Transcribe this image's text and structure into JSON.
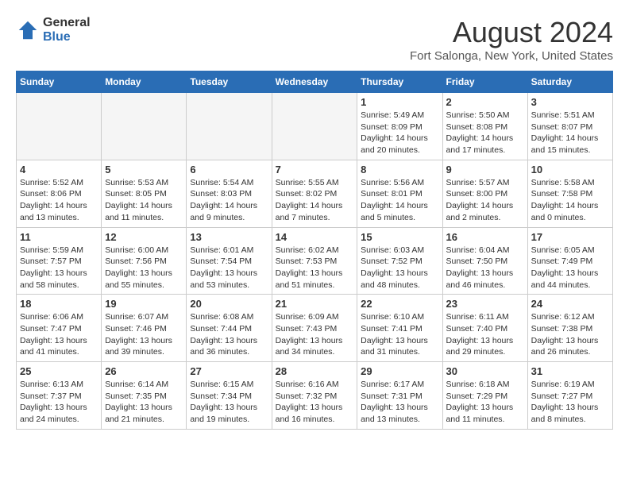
{
  "logo": {
    "general": "General",
    "blue": "Blue"
  },
  "title": "August 2024",
  "location": "Fort Salonga, New York, United States",
  "days_of_week": [
    "Sunday",
    "Monday",
    "Tuesday",
    "Wednesday",
    "Thursday",
    "Friday",
    "Saturday"
  ],
  "weeks": [
    [
      {
        "day": "",
        "info": ""
      },
      {
        "day": "",
        "info": ""
      },
      {
        "day": "",
        "info": ""
      },
      {
        "day": "",
        "info": ""
      },
      {
        "day": "1",
        "info": "Sunrise: 5:49 AM\nSunset: 8:09 PM\nDaylight: 14 hours\nand 20 minutes."
      },
      {
        "day": "2",
        "info": "Sunrise: 5:50 AM\nSunset: 8:08 PM\nDaylight: 14 hours\nand 17 minutes."
      },
      {
        "day": "3",
        "info": "Sunrise: 5:51 AM\nSunset: 8:07 PM\nDaylight: 14 hours\nand 15 minutes."
      }
    ],
    [
      {
        "day": "4",
        "info": "Sunrise: 5:52 AM\nSunset: 8:06 PM\nDaylight: 14 hours\nand 13 minutes."
      },
      {
        "day": "5",
        "info": "Sunrise: 5:53 AM\nSunset: 8:05 PM\nDaylight: 14 hours\nand 11 minutes."
      },
      {
        "day": "6",
        "info": "Sunrise: 5:54 AM\nSunset: 8:03 PM\nDaylight: 14 hours\nand 9 minutes."
      },
      {
        "day": "7",
        "info": "Sunrise: 5:55 AM\nSunset: 8:02 PM\nDaylight: 14 hours\nand 7 minutes."
      },
      {
        "day": "8",
        "info": "Sunrise: 5:56 AM\nSunset: 8:01 PM\nDaylight: 14 hours\nand 5 minutes."
      },
      {
        "day": "9",
        "info": "Sunrise: 5:57 AM\nSunset: 8:00 PM\nDaylight: 14 hours\nand 2 minutes."
      },
      {
        "day": "10",
        "info": "Sunrise: 5:58 AM\nSunset: 7:58 PM\nDaylight: 14 hours\nand 0 minutes."
      }
    ],
    [
      {
        "day": "11",
        "info": "Sunrise: 5:59 AM\nSunset: 7:57 PM\nDaylight: 13 hours\nand 58 minutes."
      },
      {
        "day": "12",
        "info": "Sunrise: 6:00 AM\nSunset: 7:56 PM\nDaylight: 13 hours\nand 55 minutes."
      },
      {
        "day": "13",
        "info": "Sunrise: 6:01 AM\nSunset: 7:54 PM\nDaylight: 13 hours\nand 53 minutes."
      },
      {
        "day": "14",
        "info": "Sunrise: 6:02 AM\nSunset: 7:53 PM\nDaylight: 13 hours\nand 51 minutes."
      },
      {
        "day": "15",
        "info": "Sunrise: 6:03 AM\nSunset: 7:52 PM\nDaylight: 13 hours\nand 48 minutes."
      },
      {
        "day": "16",
        "info": "Sunrise: 6:04 AM\nSunset: 7:50 PM\nDaylight: 13 hours\nand 46 minutes."
      },
      {
        "day": "17",
        "info": "Sunrise: 6:05 AM\nSunset: 7:49 PM\nDaylight: 13 hours\nand 44 minutes."
      }
    ],
    [
      {
        "day": "18",
        "info": "Sunrise: 6:06 AM\nSunset: 7:47 PM\nDaylight: 13 hours\nand 41 minutes."
      },
      {
        "day": "19",
        "info": "Sunrise: 6:07 AM\nSunset: 7:46 PM\nDaylight: 13 hours\nand 39 minutes."
      },
      {
        "day": "20",
        "info": "Sunrise: 6:08 AM\nSunset: 7:44 PM\nDaylight: 13 hours\nand 36 minutes."
      },
      {
        "day": "21",
        "info": "Sunrise: 6:09 AM\nSunset: 7:43 PM\nDaylight: 13 hours\nand 34 minutes."
      },
      {
        "day": "22",
        "info": "Sunrise: 6:10 AM\nSunset: 7:41 PM\nDaylight: 13 hours\nand 31 minutes."
      },
      {
        "day": "23",
        "info": "Sunrise: 6:11 AM\nSunset: 7:40 PM\nDaylight: 13 hours\nand 29 minutes."
      },
      {
        "day": "24",
        "info": "Sunrise: 6:12 AM\nSunset: 7:38 PM\nDaylight: 13 hours\nand 26 minutes."
      }
    ],
    [
      {
        "day": "25",
        "info": "Sunrise: 6:13 AM\nSunset: 7:37 PM\nDaylight: 13 hours\nand 24 minutes."
      },
      {
        "day": "26",
        "info": "Sunrise: 6:14 AM\nSunset: 7:35 PM\nDaylight: 13 hours\nand 21 minutes."
      },
      {
        "day": "27",
        "info": "Sunrise: 6:15 AM\nSunset: 7:34 PM\nDaylight: 13 hours\nand 19 minutes."
      },
      {
        "day": "28",
        "info": "Sunrise: 6:16 AM\nSunset: 7:32 PM\nDaylight: 13 hours\nand 16 minutes."
      },
      {
        "day": "29",
        "info": "Sunrise: 6:17 AM\nSunset: 7:31 PM\nDaylight: 13 hours\nand 13 minutes."
      },
      {
        "day": "30",
        "info": "Sunrise: 6:18 AM\nSunset: 7:29 PM\nDaylight: 13 hours\nand 11 minutes."
      },
      {
        "day": "31",
        "info": "Sunrise: 6:19 AM\nSunset: 7:27 PM\nDaylight: 13 hours\nand 8 minutes."
      }
    ]
  ]
}
